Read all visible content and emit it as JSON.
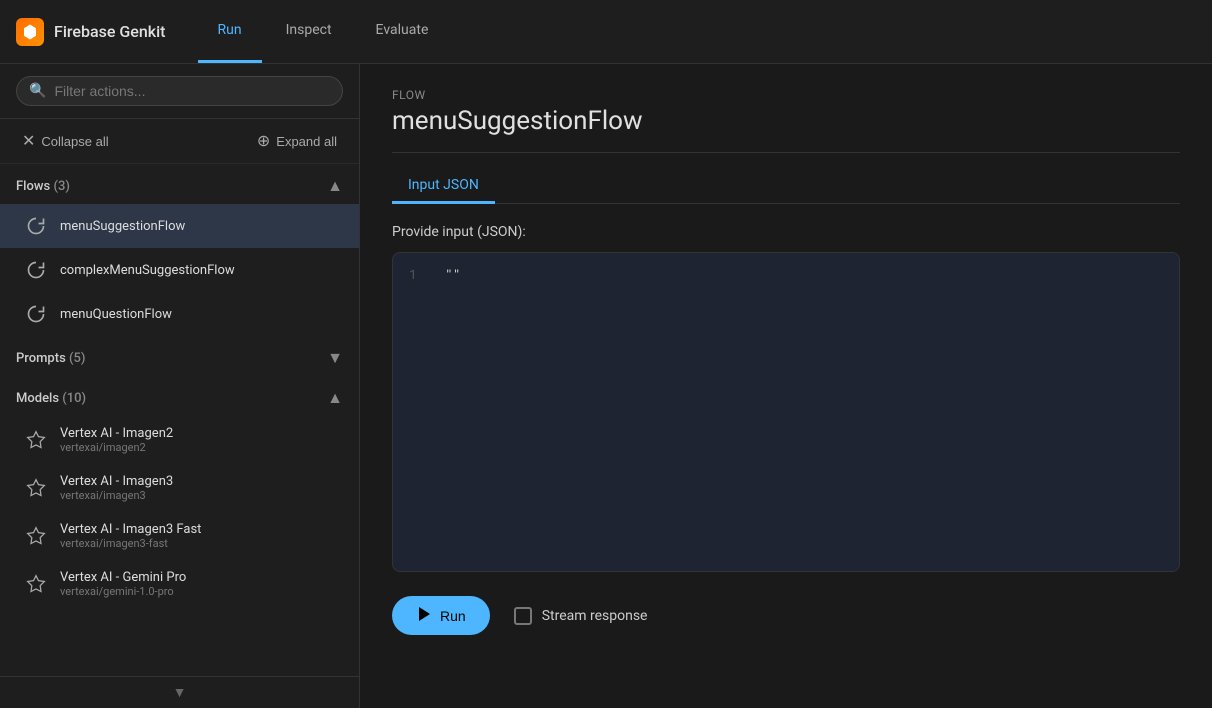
{
  "app": {
    "logo_text": "Firebase Genkit"
  },
  "top_nav": {
    "tabs": [
      {
        "id": "run",
        "label": "Run",
        "active": true
      },
      {
        "id": "inspect",
        "label": "Inspect",
        "active": false
      },
      {
        "id": "evaluate",
        "label": "Evaluate",
        "active": false
      }
    ]
  },
  "sidebar": {
    "search_placeholder": "Filter actions...",
    "collapse_label": "Collapse all",
    "expand_label": "Expand all",
    "sections": [
      {
        "id": "flows",
        "title": "Flows",
        "count": 3,
        "expanded": true,
        "items": [
          {
            "id": "menuSuggestionFlow",
            "label": "menuSuggestionFlow",
            "selected": true
          },
          {
            "id": "complexMenuSuggestionFlow",
            "label": "complexMenuSuggestionFlow",
            "selected": false
          },
          {
            "id": "menuQuestionFlow",
            "label": "menuQuestionFlow",
            "selected": false
          }
        ]
      },
      {
        "id": "prompts",
        "title": "Prompts",
        "count": 5,
        "expanded": false,
        "items": []
      },
      {
        "id": "models",
        "title": "Models",
        "count": 10,
        "expanded": true,
        "items": [
          {
            "id": "vertex-imagen2",
            "label": "Vertex AI - Imagen2",
            "sublabel": "vertexai/imagen2"
          },
          {
            "id": "vertex-imagen3",
            "label": "Vertex AI - Imagen3",
            "sublabel": "vertexai/imagen3"
          },
          {
            "id": "vertex-imagen3-fast",
            "label": "Vertex AI - Imagen3 Fast",
            "sublabel": "vertexai/imagen3-fast"
          },
          {
            "id": "vertex-gemini-pro",
            "label": "Vertex AI - Gemini Pro",
            "sublabel": "vertexai/gemini-1.0-pro"
          }
        ]
      }
    ]
  },
  "content": {
    "flow_label": "Flow",
    "flow_title": "menuSuggestionFlow",
    "tabs": [
      {
        "id": "input-json",
        "label": "Input JSON",
        "active": true
      }
    ],
    "provide_label": "Provide input (JSON):",
    "editor_lines": [
      {
        "number": "1",
        "content": "\"\""
      }
    ],
    "run_button": "Run",
    "stream_response_label": "Stream response"
  },
  "icons": {
    "logo": "◈",
    "search": "🔍",
    "flow": "↻",
    "model": "✦",
    "play": "▶",
    "chevron_down": "▾",
    "chevron_up": "▴",
    "cross": "✕"
  }
}
